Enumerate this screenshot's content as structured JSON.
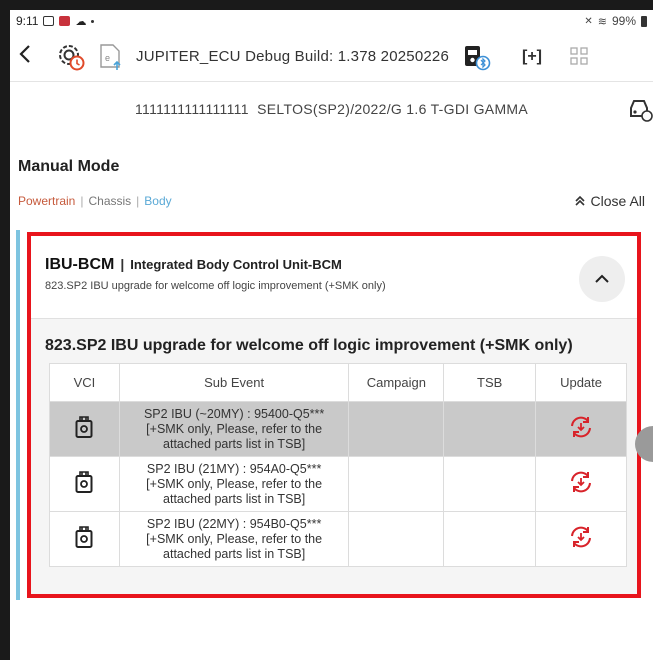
{
  "status_bar": {
    "time": "9:11",
    "battery": "99%",
    "icons": [
      "image-icon",
      "app-icon",
      "cloud-icon",
      "dot",
      "mute-icon",
      "wifi-icon",
      "battery-icon"
    ]
  },
  "toolbar": {
    "back_icon": "chevron-left-icon",
    "app_icon": "gear-alert-icon",
    "file_icon": "file-upload-icon",
    "title": "JUPITER_ECU Debug Build: 1.378 20250226",
    "vci_icon": "vci-bluetooth-icon",
    "expand_icon": "expand-icon",
    "expand_glyph": "[+]",
    "grid_icon": "grid-icon"
  },
  "vehicle": {
    "info": "1111111111111111  SELTOS(SP2)/2022/G 1.6 T-GDI GAMMA",
    "car_icon": "car-diagnostic-icon"
  },
  "page": {
    "title": "Manual Mode",
    "filters": [
      "Powertrain",
      "Chassis",
      "Body"
    ],
    "filter_separator": "|",
    "close_all_label": "Close All"
  },
  "card": {
    "code": "IBU-BCM",
    "separator": "|",
    "name": "Integrated Body Control Unit-BCM",
    "subtitle": "823.SP2 IBU upgrade for welcome off logic improvement (+SMK only)",
    "event_title": "823.SP2 IBU upgrade for welcome off logic improvement (+SMK only)",
    "columns": [
      "VCI",
      "Sub Event",
      "Campaign",
      "TSB",
      "Update"
    ],
    "rows": [
      {
        "sub_event_line1": "SP2 IBU (~20MY) : 95400-Q5***",
        "sub_event_line2": "[+SMK only, Please, refer to the",
        "sub_event_line3": "attached parts list in TSB]",
        "campaign": "",
        "tsb": "",
        "selected": true
      },
      {
        "sub_event_line1": "SP2 IBU (21MY) : 954A0-Q5***",
        "sub_event_line2": "[+SMK only, Please, refer to the",
        "sub_event_line3": "attached parts list in TSB]",
        "campaign": "",
        "tsb": "",
        "selected": false
      },
      {
        "sub_event_line1": "SP2 IBU (22MY) : 954B0-Q5***",
        "sub_event_line2": "[+SMK only, Please, refer to the",
        "sub_event_line3": "attached parts list in TSB]",
        "campaign": "",
        "tsb": "",
        "selected": false
      }
    ]
  },
  "colors": {
    "highlight": "#e8141c",
    "powertrain": "#c65a3c",
    "body": "#5aa9d6",
    "update_icon": "#d8232a",
    "selected_row": "#c9c9c9"
  }
}
